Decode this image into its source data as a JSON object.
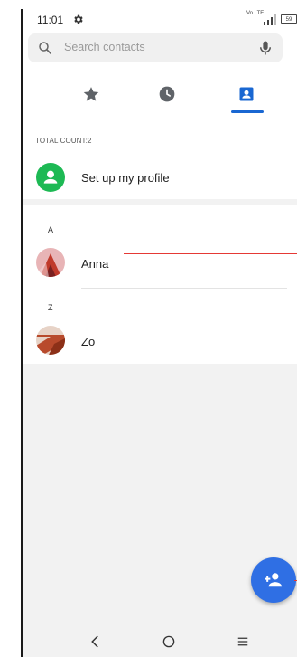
{
  "status_bar": {
    "time": "11:01",
    "network_type": "Vo LTE",
    "battery": "59"
  },
  "search": {
    "placeholder": "Search contacts"
  },
  "tabs": [
    {
      "id": "favorites",
      "icon": "star-icon",
      "selected": false
    },
    {
      "id": "recents",
      "icon": "clock-icon",
      "selected": false
    },
    {
      "id": "contacts",
      "icon": "contact-card-icon",
      "selected": true
    }
  ],
  "total_count_label": "TOTAL COUNT:2",
  "profile": {
    "label": "Set up my profile"
  },
  "contacts": [
    {
      "section": "A",
      "name": "Anna"
    },
    {
      "section": "Z",
      "name": "Zo"
    }
  ],
  "fab_icon": "add-contact-icon",
  "colors": {
    "accent": "#1967d2",
    "fab": "#2f6fe4",
    "profile_avatar": "#1db954",
    "annotation": "#e53935"
  }
}
